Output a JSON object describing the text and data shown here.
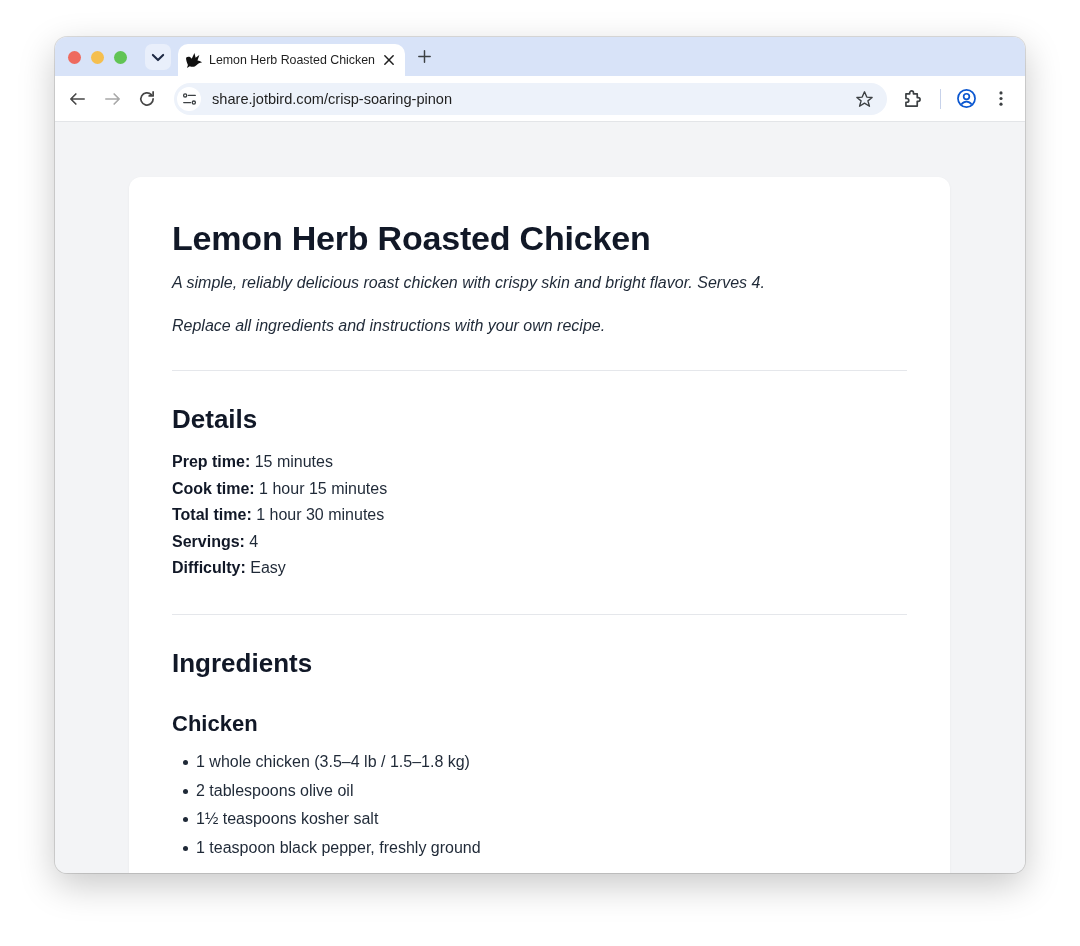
{
  "browser": {
    "tabs": [
      {
        "title": "Lemon Herb Roasted Chicken",
        "selected": true
      }
    ],
    "nav": [
      {
        "kind": "back",
        "disabled": false
      },
      {
        "kind": "forward",
        "disabled": true
      },
      {
        "kind": "reload",
        "disabled": false
      }
    ],
    "address_bar": {
      "url": "share.jotbird.com/crisp-soaring-pinon"
    }
  },
  "recipe": {
    "title": "Lemon Herb Roasted Chicken",
    "intro": [
      "A simple, reliably delicious roast chicken with crispy skin and bright flavor. Serves 4.",
      "Replace all ingredients and instructions with your own recipe."
    ],
    "sections": [
      {
        "kind": "details",
        "heading": "Details",
        "lines": [
          "**Prep time:** 15 minutes",
          "**Cook time:** 1 hour 15 minutes",
          "**Total time:** 1 hour 30 minutes",
          "**Servings:** 4",
          "**Difficulty:** Easy"
        ]
      },
      {
        "kind": "ingredients",
        "heading": "Ingredients",
        "groups": [
          {
            "heading": "Chicken",
            "items": [
              "1 whole chicken (3.5–4 lb / 1.5–1.8 kg)",
              "2 tablespoons olive oil",
              "1½ teaspoons kosher salt",
              "1 teaspoon black pepper, freshly ground"
            ]
          }
        ]
      }
    ]
  }
}
